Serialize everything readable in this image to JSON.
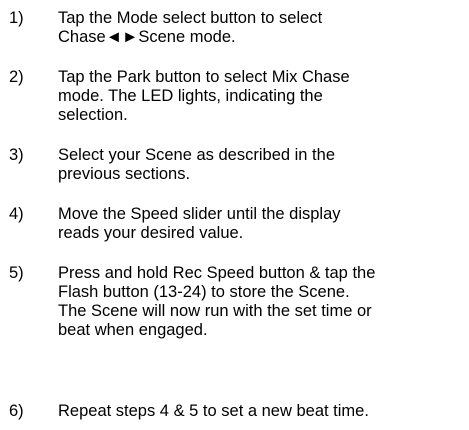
{
  "steps": [
    {
      "number": "1)",
      "lines": [
        "Tap the Mode select button to select",
        "Chase◄►Scene mode."
      ]
    },
    {
      "number": "2)",
      "lines": [
        "Tap the Park button to select Mix Chase",
        "mode. The LED lights, indicating the",
        "selection."
      ]
    },
    {
      "number": "3)",
      "lines": [
        "Select your Scene as described in the",
        "previous sections."
      ]
    },
    {
      "number": "4)",
      "lines": [
        "Move the Speed slider until the display",
        "reads your desired value."
      ]
    },
    {
      "number": "5)",
      "lines": [
        "Press and hold Rec Speed button & tap the",
        "Flash button (13-24) to store the Scene.",
        "The Scene will now run with the set time or",
        "beat when engaged."
      ]
    },
    {
      "number": "6)",
      "lines": [
        "Repeat steps 4 & 5 to set a new beat time."
      ]
    }
  ]
}
